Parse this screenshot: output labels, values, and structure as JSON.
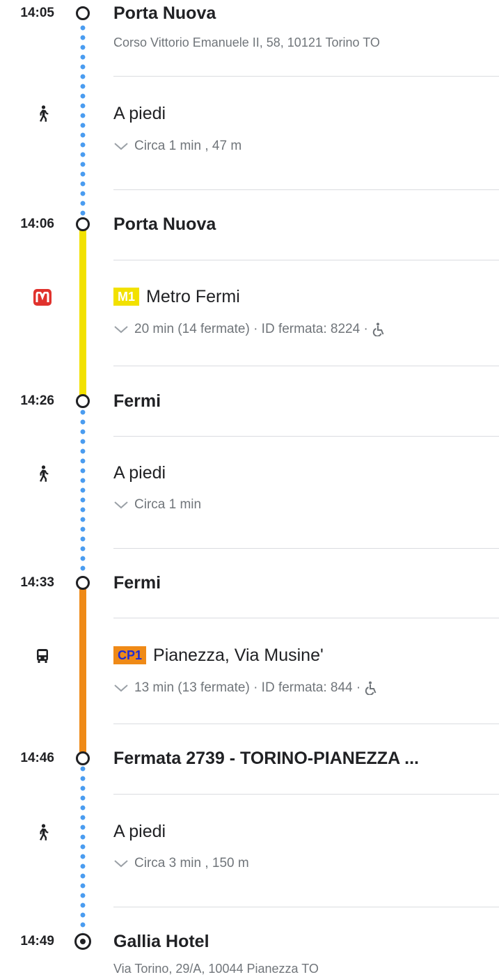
{
  "colors": {
    "walk_line": "#4a9cf0",
    "metro_line": "#f2e100",
    "bus_line": "#ef8a17",
    "metro_logo": "#e0322d",
    "m1_badge": "#f2e100",
    "cp1_badge": "#ef8a17",
    "cp1_text": "#1f2bd6"
  },
  "icons": {
    "walk": "walk-icon",
    "metro": "metro-logo-icon",
    "bus": "bus-icon",
    "chevron": "chevron-down-icon",
    "wheelchair": "wheelchair-icon",
    "stop": "stop-node-icon",
    "destination": "destination-node-icon"
  },
  "stops": [
    {
      "time": "14:05",
      "name": "Porta Nuova",
      "address": "Corso Vittorio Emanuele II, 58, 10121 Torino TO"
    },
    {
      "time": "14:06",
      "name": "Porta Nuova"
    },
    {
      "time": "14:26",
      "name": "Fermi"
    },
    {
      "time": "14:33",
      "name": "Fermi"
    },
    {
      "time": "14:46",
      "name": "Fermata 2739 - TORINO-PIANEZZA ..."
    },
    {
      "time": "14:49",
      "name": "Gallia Hotel",
      "address": "Via Torino, 29/A, 10044 Pianezza TO"
    }
  ],
  "segments": [
    {
      "mode": "walk",
      "title": "A piedi",
      "detail": "Circa 1 min , 47 m"
    },
    {
      "mode": "metro",
      "line": "M1",
      "title": "Metro Fermi",
      "detail": "20 min (14 fermate) · ID fermata: 8224 ·"
    },
    {
      "mode": "walk",
      "title": "A piedi",
      "detail": "Circa 1 min"
    },
    {
      "mode": "bus",
      "line": "CP1",
      "title": "Pianezza, Via Musine'",
      "detail": "13 min (13 fermate) · ID fermata: 844 ·"
    },
    {
      "mode": "walk",
      "title": "A piedi",
      "detail": "Circa 3 min , 150 m"
    }
  ]
}
